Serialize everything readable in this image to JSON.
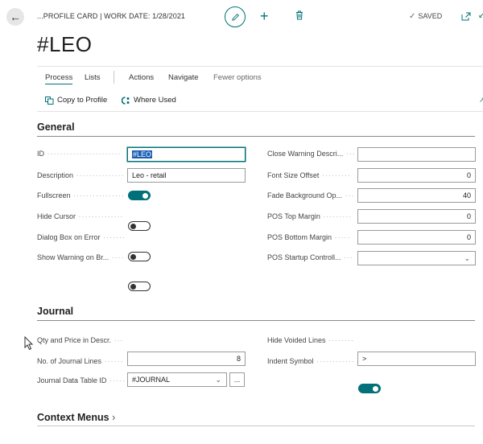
{
  "header": {
    "breadcrumb": "...PROFILE CARD | WORK DATE: 1/28/2021",
    "saved_label": "SAVED",
    "title": "#LEO"
  },
  "tabs": [
    {
      "label": "Process",
      "active": true
    },
    {
      "label": "Lists"
    },
    {
      "label": "Actions"
    },
    {
      "label": "Navigate"
    },
    {
      "label": "Fewer options"
    }
  ],
  "actions": {
    "copy_to_profile": "Copy to Profile",
    "where_used": "Where Used"
  },
  "general": {
    "title": "General",
    "id": {
      "label": "ID",
      "value": "#LEO"
    },
    "description": {
      "label": "Description",
      "value": "Leo - retail"
    },
    "fullscreen": {
      "label": "Fullscreen",
      "on": true
    },
    "hide_cursor": {
      "label": "Hide Cursor",
      "on": false
    },
    "dialog_box": {
      "label": "Dialog Box on Error",
      "on": false
    },
    "show_warning": {
      "label": "Show Warning on Br...",
      "on": false
    },
    "close_warning": {
      "label": "Close Warning Descri...",
      "value": ""
    },
    "font_size_offset": {
      "label": "Font Size Offset",
      "value": "0"
    },
    "fade_background": {
      "label": "Fade Background Op...",
      "value": "40"
    },
    "pos_top_margin": {
      "label": "POS Top Margin",
      "value": "0"
    },
    "pos_bottom_margin": {
      "label": "POS Bottom Margin",
      "value": "0"
    },
    "pos_startup": {
      "label": "POS Startup Controll...",
      "value": ""
    }
  },
  "journal": {
    "title": "Journal",
    "qty_price": {
      "label": "Qty and Price in Descr.",
      "on": false
    },
    "no_lines": {
      "label": "No. of Journal Lines",
      "value": "8"
    },
    "data_table": {
      "label": "Journal Data Table ID",
      "value": "#JOURNAL",
      "more": "..."
    },
    "hide_voided": {
      "label": "Hide Voided Lines",
      "on": true
    },
    "indent_symbol": {
      "label": "Indent Symbol",
      "value": ">"
    }
  },
  "context_menus": {
    "title": "Context Menus",
    "chevron": "›"
  },
  "colors": {
    "accent": "#00707a",
    "selection": "#1a5fb4"
  }
}
